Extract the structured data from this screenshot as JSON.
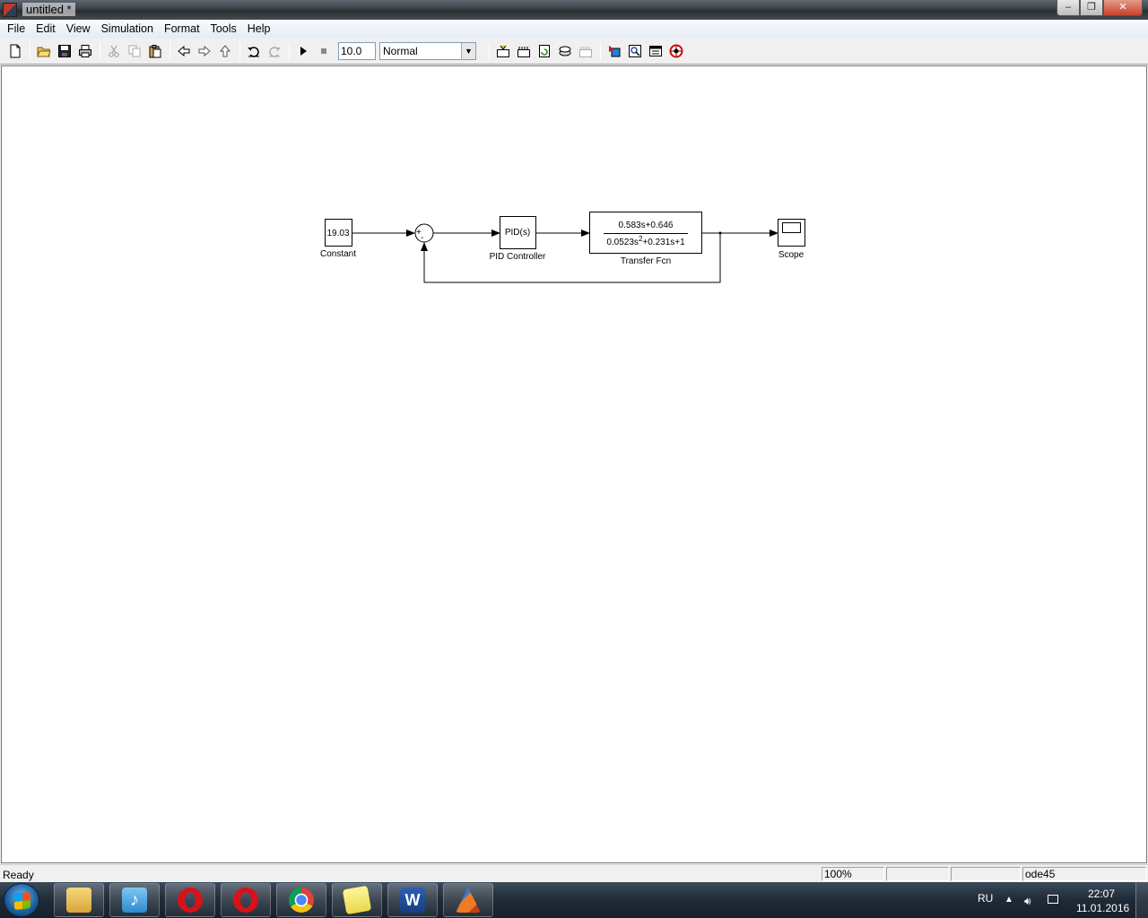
{
  "window": {
    "title": "untitled *",
    "minimize_glyph": "‒",
    "maximize_glyph": "❐",
    "close_glyph": "✕"
  },
  "menu": [
    "File",
    "Edit",
    "View",
    "Simulation",
    "Format",
    "Tools",
    "Help"
  ],
  "toolbar": {
    "icons": [
      "new-file-icon",
      "open-icon",
      "save-icon",
      "print-icon",
      "cut-icon",
      "copy-icon",
      "paste-icon",
      "back-icon",
      "forward-icon",
      "up-icon",
      "undo-icon",
      "redo-icon",
      "start-simulation-icon",
      "stop-simulation-icon",
      "build-icon",
      "update-diagram-icon",
      "refresh-icon",
      "library-browser-icon",
      "model-explorer-icon",
      "debugger-icon",
      "help-icon"
    ],
    "stop_time": "10.0",
    "sim_mode": "Normal"
  },
  "model": {
    "constant": {
      "value": "19.03",
      "label": "Constant"
    },
    "sum": {
      "plus_sign": "+",
      "minus_sign": "-"
    },
    "pid": {
      "text": "PID(s)",
      "label": "PID Controller"
    },
    "transfer_fcn": {
      "numerator": "0.583s+0.646",
      "denominator_prefix": "0.0523s",
      "denominator_exp": "2",
      "denominator_suffix": "+0.231s+1",
      "label": "Transfer Fcn"
    },
    "scope": {
      "label": "Scope"
    }
  },
  "status": {
    "text": "Ready",
    "zoom": "100%",
    "cell2": "",
    "cell3": "",
    "solver": "ode45"
  },
  "taskbar": {
    "apps": [
      "file-explorer",
      "music-app",
      "opera",
      "opera",
      "chrome",
      "sticky-notes",
      "word",
      "matlab"
    ],
    "language": "RU",
    "time": "22:07",
    "date": "11.01.2016"
  }
}
